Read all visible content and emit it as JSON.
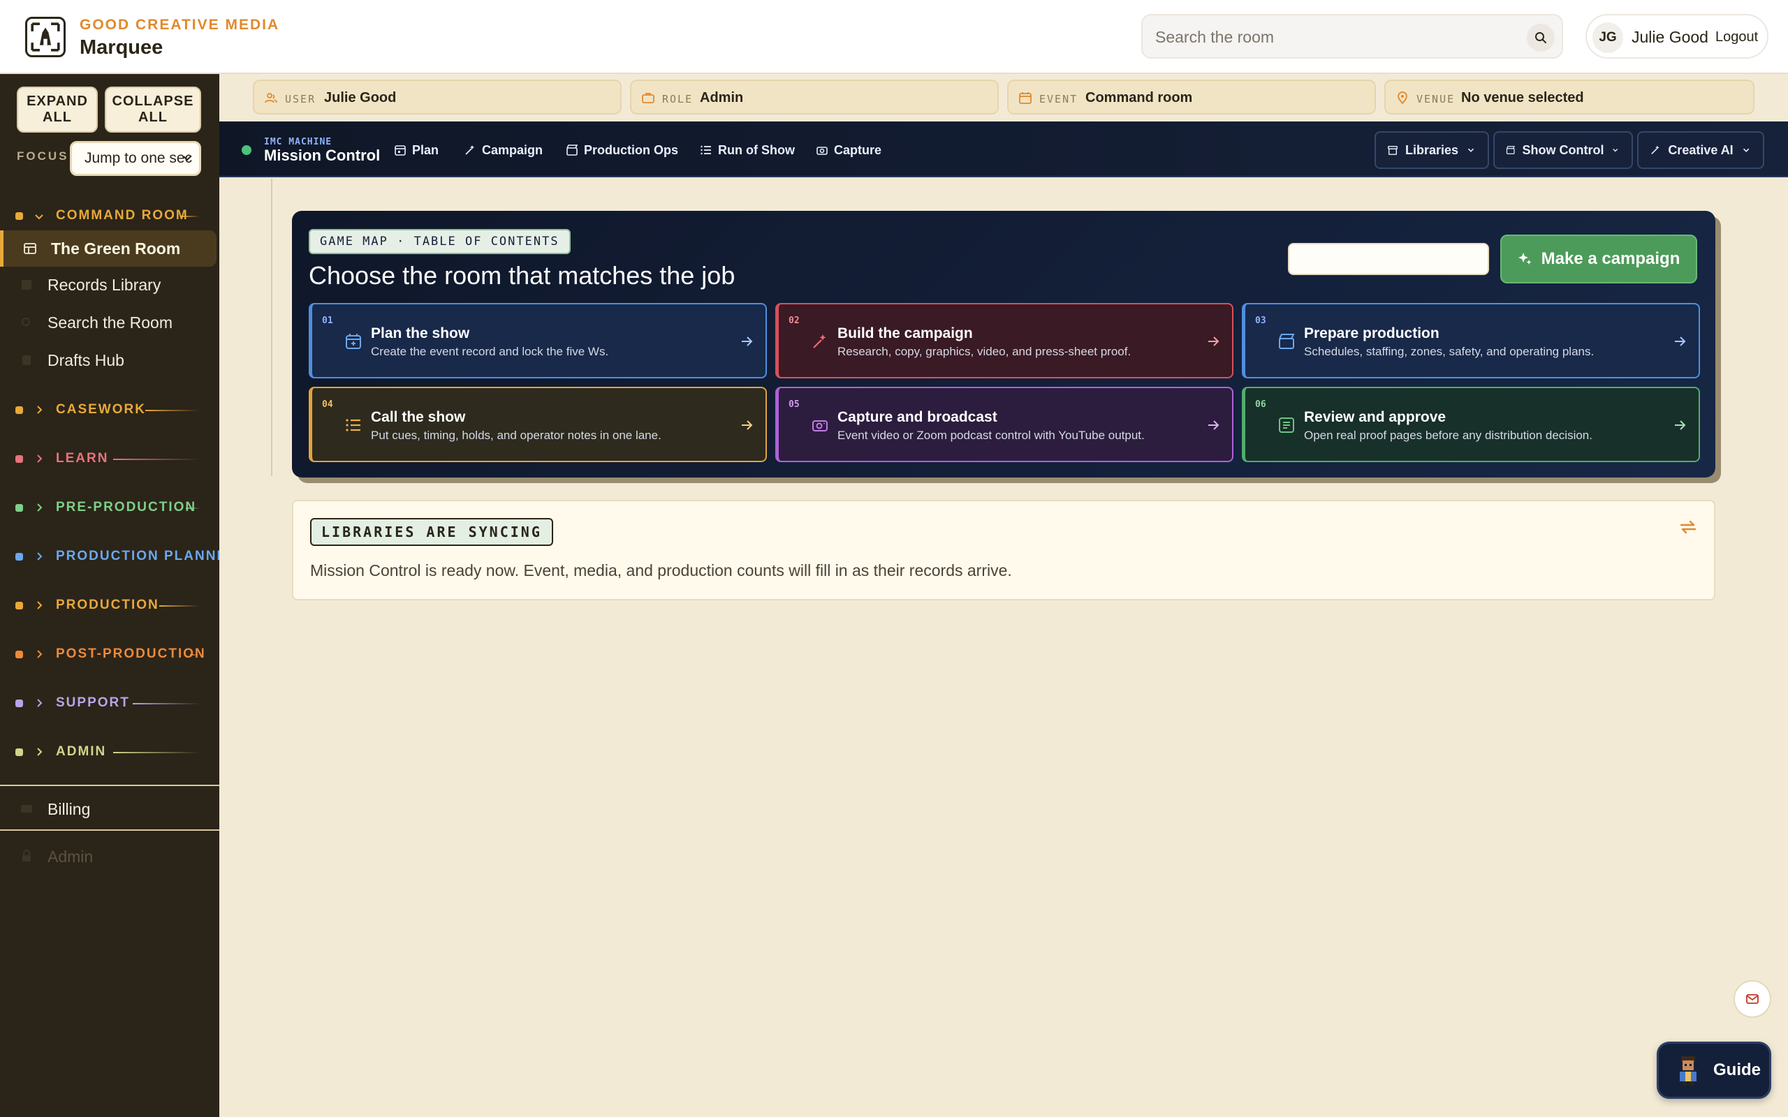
{
  "header": {
    "org": "GOOD CREATIVE MEDIA",
    "app": "Marquee",
    "search_placeholder": "Search the room",
    "user_initials": "JG",
    "user_name": "Julie Good",
    "logout": "Logout"
  },
  "sidebar": {
    "expand": "EXPAND ALL",
    "collapse": "COLLAPSE ALL",
    "focus_label": "FOCUS",
    "focus_value": "Jump to one sec",
    "groups": [
      {
        "label": "COMMAND ROOM",
        "color": "#e8a93a",
        "expanded": true
      },
      {
        "label": "CASEWORK",
        "color": "#e8a93a"
      },
      {
        "label": "LEARN",
        "color": "#e8737c"
      },
      {
        "label": "PRE-PRODUCTION",
        "color": "#7fcf8a"
      },
      {
        "label": "PRODUCTION PLANNING",
        "color": "#6aa8ee"
      },
      {
        "label": "PRODUCTION",
        "color": "#e8a93a"
      },
      {
        "label": "POST-PRODUCTION",
        "color": "#ec8a3a"
      },
      {
        "label": "SUPPORT",
        "color": "#b9a4e8"
      },
      {
        "label": "ADMIN",
        "color": "#cfd68a"
      }
    ],
    "items": [
      {
        "label": "The Green Room"
      },
      {
        "label": "Records Library"
      },
      {
        "label": "Search the Room"
      },
      {
        "label": "Drafts Hub"
      },
      {
        "label": "Billing"
      },
      {
        "label": "Admin"
      }
    ]
  },
  "context": [
    {
      "key": "USER",
      "value": "Julie Good"
    },
    {
      "key": "ROLE",
      "value": "Admin"
    },
    {
      "key": "EVENT",
      "value": "Command room"
    },
    {
      "key": "VENUE",
      "value": "No venue selected"
    }
  ],
  "nav": {
    "eyebrow": "IMC MACHINE",
    "title": "Mission Control",
    "links": [
      "Plan",
      "Campaign",
      "Production Ops",
      "Run of Show",
      "Capture"
    ],
    "dropdowns": [
      "Libraries",
      "Show Control",
      "Creative AI"
    ]
  },
  "map": {
    "badge": "GAME MAP · TABLE OF CONTENTS",
    "title": "Choose the room that matches the job",
    "cta": "Make a campaign",
    "cards": [
      {
        "num": "01",
        "title": "Plan the show",
        "desc": "Create the event record and lock the five Ws.",
        "color": "#4f8fe0",
        "bg": "#18294a"
      },
      {
        "num": "02",
        "title": "Build the campaign",
        "desc": "Research, copy, graphics, video, and press-sheet proof.",
        "color": "#d8505a",
        "bg": "#3a1a24"
      },
      {
        "num": "03",
        "title": "Prepare production",
        "desc": "Schedules, staffing, zones, safety, and operating plans.",
        "color": "#4f8fe0",
        "bg": "#18294a"
      },
      {
        "num": "04",
        "title": "Call the show",
        "desc": "Put cues, timing, holds, and operator notes in one lane.",
        "color": "#e0a53a",
        "bg": "#2e2a1e"
      },
      {
        "num": "05",
        "title": "Capture and broadcast",
        "desc": "Event video or Zoom podcast control with YouTube output.",
        "color": "#b060d8",
        "bg": "#2c1d3e"
      },
      {
        "num": "06",
        "title": "Review and approve",
        "desc": "Open real proof pages before any distribution decision.",
        "color": "#4fae6a",
        "bg": "#18302a"
      }
    ]
  },
  "sync": {
    "badge": "LIBRARIES ARE SYNCING",
    "text": "Mission Control is ready now. Event, media, and production counts will fill in as their records arrive."
  },
  "guide": {
    "label": "Guide"
  }
}
